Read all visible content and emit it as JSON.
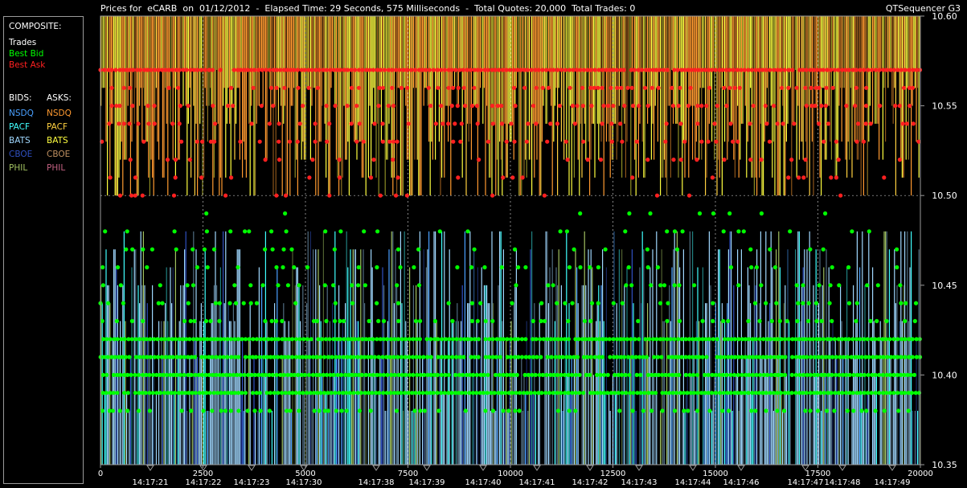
{
  "header": {
    "title": "Prices for  eCARB  on  01/12/2012  -  Elapsed Time: 29 Seconds, 575 Milliseconds  -  Total Quotes: 20,000  Total Trades: 0",
    "app_name": "QTSequencer G3"
  },
  "legend": {
    "composite_label": "COMPOSITE:",
    "trades_label": "Trades",
    "best_bid_label": "Best Bid",
    "best_ask_label": "Best Ask",
    "bids_label": "BIDS:",
    "asks_label": "ASKS:",
    "bids": [
      "NSDQ",
      "PACF",
      "BATS",
      "CBOE",
      "PHIL"
    ],
    "asks": [
      "NSDQ",
      "PACF",
      "BATS",
      "CBOE",
      "PHIL"
    ]
  },
  "colors": {
    "trades": "#ffffff",
    "best_bid": "#00ff00",
    "best_ask": "#ff2020",
    "bid_nsdq": "#4aa0ff",
    "bid_pacf": "#40ffff",
    "bid_bats": "#a0d8ff",
    "bid_cboe": "#3050c0",
    "bid_phil": "#a0c060",
    "ask_nsdq": "#ff9a30",
    "ask_pacf": "#ffd040",
    "ask_bats": "#ffff40",
    "ask_cboe": "#c09060",
    "ask_phil": "#c06080"
  },
  "chart_data": {
    "type": "line",
    "title": "Prices for  eCARB  on  01/12/2012",
    "xlim": [
      0,
      20000
    ],
    "ylim": [
      10.35,
      10.6
    ],
    "x_ticks": [
      0,
      2500,
      5000,
      7500,
      10000,
      12500,
      15000,
      17500,
      20000
    ],
    "y_ticks": [
      10.35,
      10.4,
      10.45,
      10.5,
      10.55,
      10.6
    ],
    "y_tick_labels": [
      "10.35",
      "10.40",
      "10.45",
      "10.50",
      "10.55",
      "10.60"
    ],
    "time_labels": [
      "14:17:21",
      "14:17:22",
      "14:17:23",
      "14:17:30",
      "14:17:38",
      "14:17:39",
      "14:17:40",
      "14:17:41",
      "14:17:42",
      "14:17:43",
      "14:17:44",
      "14:17:46",
      "14:17:47",
      "14:17:48",
      "14:17:49"
    ],
    "total_quotes": 20000,
    "total_trades": 0,
    "series": [
      {
        "name": "Best Ask",
        "levels": [
          10.57,
          10.56,
          10.55,
          10.54,
          10.53,
          10.52,
          10.51,
          10.5
        ],
        "weights": [
          0.95,
          0.55,
          0.55,
          0.45,
          0.4,
          0.35,
          0.25,
          0.15
        ]
      },
      {
        "name": "Best Bid",
        "levels": [
          10.49,
          10.48,
          10.47,
          10.46,
          10.45,
          10.44,
          10.43,
          10.42,
          10.41,
          10.4,
          10.39,
          10.38
        ],
        "weights": [
          0.1,
          0.2,
          0.25,
          0.3,
          0.35,
          0.4,
          0.5,
          0.95,
          0.95,
          0.95,
          0.95,
          0.7
        ]
      }
    ]
  }
}
